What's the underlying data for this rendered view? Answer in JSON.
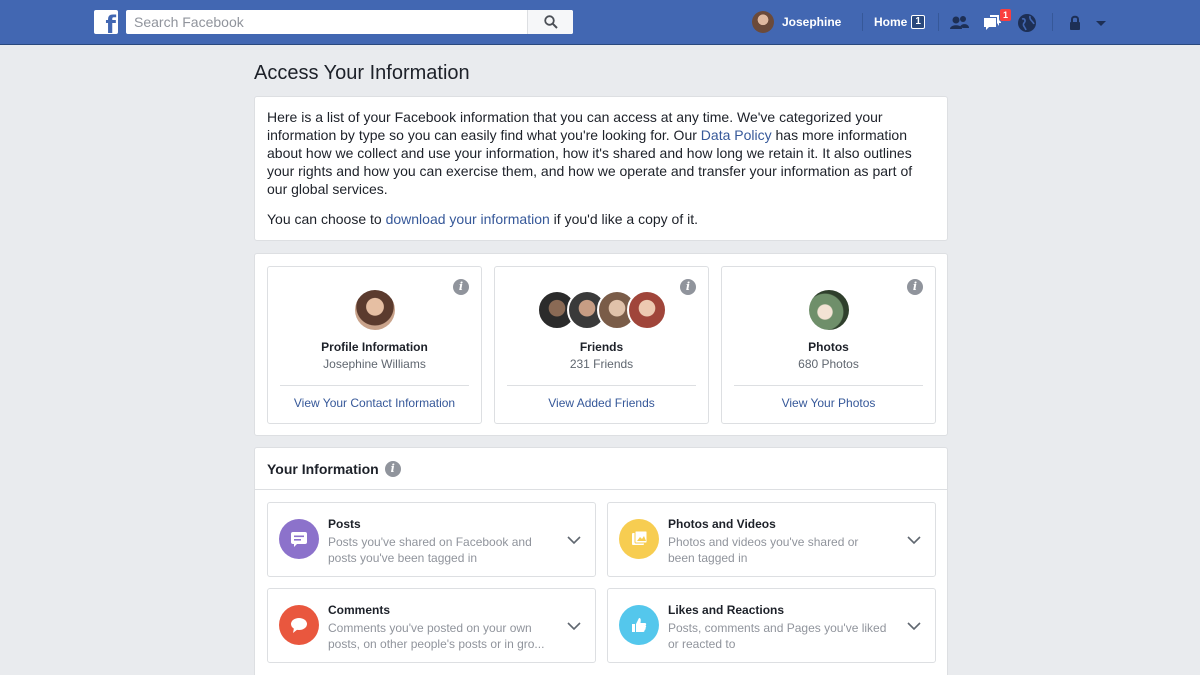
{
  "topbar": {
    "search_placeholder": "Search Facebook",
    "user_name": "Josephine",
    "home_label": "Home",
    "home_count": "1",
    "notification_count": "1",
    "brand_color": "#4267b2"
  },
  "page": {
    "title": "Access Your Information"
  },
  "intro": {
    "text_1": "Here is a list of your Facebook information that you can access at any time. We've categorized your information by type so you can easily find what you're looking for. Our ",
    "link_data_policy": "Data Policy",
    "text_2": " has more information about how we collect and use your information, how it's shared and how long we retain it. It also outlines your rights and how you can exercise them, and how we operate and transfer your information as part of our global services.",
    "text_3": "You can choose to ",
    "link_download": "download your information",
    "text_4": " if you'd like a copy of it."
  },
  "summary": [
    {
      "title": "Profile Information",
      "subtitle": "Josephine Williams",
      "link": "View Your Contact Information",
      "icon": "info-icon"
    },
    {
      "title": "Friends",
      "subtitle": "231 Friends",
      "link": "View Added Friends",
      "icon": "info-icon"
    },
    {
      "title": "Photos",
      "subtitle": "680 Photos",
      "link": "View Your Photos",
      "icon": "info-icon"
    }
  ],
  "your_information": {
    "title": "Your Information",
    "categories": [
      {
        "title": "Posts",
        "description": "Posts you've shared on Facebook and posts you've been tagged in",
        "icon": "posts-icon",
        "color": "#8c72cb"
      },
      {
        "title": "Photos and Videos",
        "description": "Photos and videos you've shared or been tagged in",
        "icon": "photos-icon",
        "color": "#f7cd51"
      },
      {
        "title": "Comments",
        "description": "Comments you've posted on your own posts, on other people's posts or in gro...",
        "icon": "comments-icon",
        "color": "#e9573e"
      },
      {
        "title": "Likes and Reactions",
        "description": "Posts, comments and Pages you've liked or reacted to",
        "icon": "likes-icon",
        "color": "#54c7ec"
      }
    ]
  }
}
